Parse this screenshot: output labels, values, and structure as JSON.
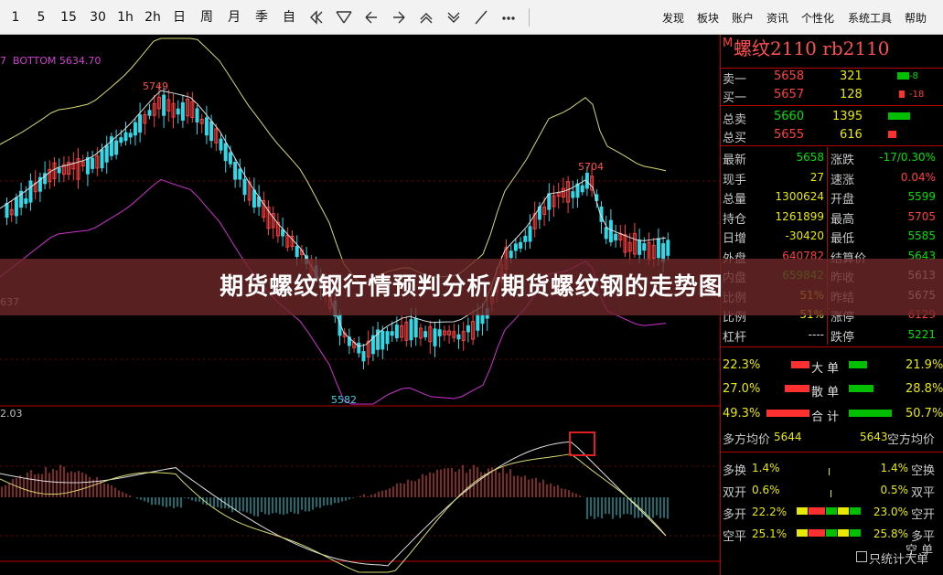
{
  "toolbar": {
    "periods": [
      "1",
      "5",
      "15",
      "30",
      "1h",
      "2h",
      "日",
      "周",
      "月",
      "季",
      "自"
    ],
    "menu": [
      "发现",
      "板块",
      "账户",
      "资讯",
      "个性化",
      "系统工具",
      "帮助"
    ]
  },
  "main_chart": {
    "bottom_label": "BOTTOM  5634.70",
    "y_tag": "637",
    "labels": {
      "high1": "5749",
      "high2": "5704",
      "low1": "5582"
    }
  },
  "macd": {
    "y_tag": "2.03"
  },
  "quote": {
    "symbol_flag": "M",
    "title": "螺纹2110 rb2110",
    "ask": {
      "label": "卖一",
      "price": "5658",
      "vol": "321",
      "chg": "-8"
    },
    "bid": {
      "label": "买一",
      "price": "5657",
      "vol": "128",
      "chg": "-18"
    },
    "total_ask": {
      "label": "总卖",
      "price": "5660",
      "vol": "1395"
    },
    "total_bid": {
      "label": "总买",
      "price": "5655",
      "vol": "616"
    },
    "stats": [
      {
        "l1": "最新",
        "v1": "5658",
        "c1": "green",
        "l2": "涨跌",
        "v2": "-17/0.30%",
        "c2": "green"
      },
      {
        "l1": "现手",
        "v1": "27",
        "c1": "yellow",
        "l2": "速涨",
        "v2": "0.04%",
        "c2": "red"
      },
      {
        "l1": "总量",
        "v1": "1300624",
        "c1": "yellow",
        "l2": "开盘",
        "v2": "5599",
        "c2": "green"
      },
      {
        "l1": "持仓",
        "v1": "1261899",
        "c1": "yellow",
        "l2": "最高",
        "v2": "5705",
        "c2": "red"
      },
      {
        "l1": "日增",
        "v1": "-30420",
        "c1": "yellow",
        "l2": "最低",
        "v2": "5585",
        "c2": "green"
      },
      {
        "l1": "外盘",
        "v1": "640782",
        "c1": "red",
        "l2": "结算价",
        "v2": "5643",
        "c2": "green"
      },
      {
        "l1": "内盘",
        "v1": "659842",
        "c1": "green",
        "l2": "昨收",
        "v2": "5613",
        "c2": "white"
      },
      {
        "l1": "比例",
        "v1": "51%",
        "c1": "yellow",
        "l2": "昨结",
        "v2": "5675",
        "c2": "white"
      },
      {
        "l1": "比例",
        "v1": "51%",
        "c1": "yellow",
        "l2": "涨停",
        "v2": "6129",
        "c2": "red"
      },
      {
        "l1": "杠杆",
        "v1": "----",
        "c1": "white",
        "l2": "跌停",
        "v2": "5221",
        "c2": "green"
      }
    ],
    "big": {
      "l_pct": "22.3%",
      "label": "大 单",
      "r_pct": "21.9%"
    },
    "retail": {
      "l_pct": "27.0%",
      "label": "散 单",
      "r_pct": "28.8%"
    },
    "total": {
      "l_pct": "49.3%",
      "label": "合 计",
      "r_pct": "50.7%"
    },
    "avg": {
      "long_label": "多方均价",
      "long": "5644",
      "short": "5643",
      "short_label": "空方均价"
    },
    "flows": [
      {
        "l1": "多换",
        "p1": "1.4%",
        "p2": "1.4%",
        "l2": "空换"
      },
      {
        "l1": "双开",
        "p1": "0.6%",
        "p2": "0.5%",
        "l2": "双平"
      },
      {
        "l1": "多开",
        "p1": "22.2%",
        "p2": "23.0%",
        "l2": "空开"
      },
      {
        "l1": "空平",
        "p1": "25.1%",
        "p2": "25.8%",
        "l2": "多平"
      }
    ],
    "bottom_flag": "空 单",
    "stat_checkbox": "只统计大单"
  },
  "banner": {
    "text": "期货螺纹钢行情预判分析/期货螺纹钢的走势图"
  }
}
